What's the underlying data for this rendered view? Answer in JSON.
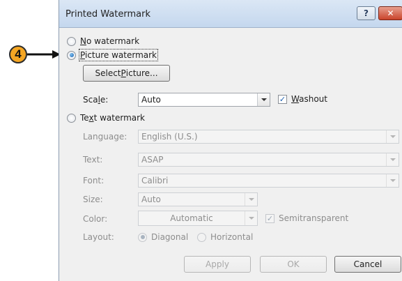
{
  "callout": {
    "number": "4"
  },
  "dialog": {
    "title": "Printed Watermark",
    "help_label": "?",
    "close_label": "✕"
  },
  "options": {
    "no_watermark": {
      "prefix": "",
      "accel": "N",
      "rest": "o watermark"
    },
    "picture_watermark": {
      "prefix": "",
      "accel": "P",
      "rest": "icture watermark"
    },
    "text_watermark": {
      "prefix": "Te",
      "accel": "x",
      "rest": "t watermark"
    }
  },
  "picture": {
    "select_button": {
      "prefix": "Select ",
      "accel": "P",
      "rest": "icture..."
    },
    "scale_label": {
      "prefix": "Sca",
      "accel": "l",
      "rest": "e:"
    },
    "scale_value": "Auto",
    "washout_label": {
      "prefix": "",
      "accel": "W",
      "rest": "ashout"
    },
    "washout_checked": true
  },
  "text": {
    "language_label": "Language:",
    "language_value": "English (U.S.)",
    "text_label": "Text:",
    "text_value": "ASAP",
    "font_label": "Font:",
    "font_value": "Calibri",
    "size_label": "Size:",
    "size_value": "Auto",
    "color_label": "Color:",
    "color_value": "Automatic",
    "semitransparent_label": "Semitransparent",
    "semitransparent_checked": true,
    "layout_label": "Layout:",
    "layout_diagonal": "Diagonal",
    "layout_horizontal": "Horizontal"
  },
  "buttons": {
    "apply": "Apply",
    "ok": "OK",
    "cancel": "Cancel"
  },
  "colors": {
    "callout": "#f5a623",
    "titlebar": "#c4d7ee",
    "close": "#c9442b"
  }
}
